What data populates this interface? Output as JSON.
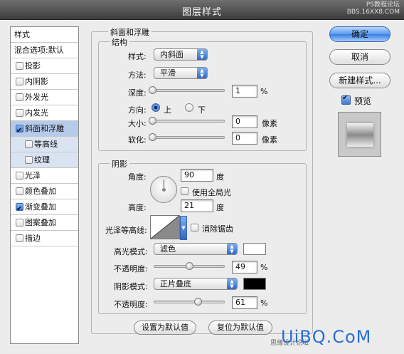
{
  "window": {
    "title": "图层样式",
    "watermark_top": "PS教程论坛\nBBS.16XX8.COM"
  },
  "style_list": {
    "items": [
      {
        "label": "样式",
        "type": "plain"
      },
      {
        "label": "混合选项:默认",
        "type": "plain"
      },
      {
        "label": "投影",
        "checked": false
      },
      {
        "label": "内阴影",
        "checked": false
      },
      {
        "label": "外发光",
        "checked": false
      },
      {
        "label": "内发光",
        "checked": false
      },
      {
        "label": "斜面和浮雕",
        "checked": true,
        "selected": true
      },
      {
        "label": "等高线",
        "checked": false,
        "sub": true
      },
      {
        "label": "纹理",
        "checked": false,
        "sub": true
      },
      {
        "label": "光泽",
        "checked": false
      },
      {
        "label": "颜色叠加",
        "checked": false
      },
      {
        "label": "渐变叠加",
        "checked": true
      },
      {
        "label": "图案叠加",
        "checked": false
      },
      {
        "label": "描边",
        "checked": false
      }
    ]
  },
  "bevel": {
    "group_title": "斜面和浮雕",
    "structure_title": "结构",
    "style_label": "样式:",
    "style_value": "内斜面",
    "technique_label": "方法:",
    "technique_value": "平滑",
    "depth_label": "深度:",
    "depth_value": "1",
    "depth_unit": "%",
    "direction_label": "方向:",
    "direction_up": "上",
    "direction_down": "下",
    "size_label": "大小:",
    "size_value": "0",
    "size_unit": "像素",
    "soften_label": "软化:",
    "soften_value": "0",
    "soften_unit": "像素"
  },
  "shading": {
    "title": "阴影",
    "angle_label": "角度:",
    "angle_value": "90",
    "angle_unit": "度",
    "global_light_label": "使用全局光",
    "altitude_label": "高度:",
    "altitude_value": "21",
    "altitude_unit": "度",
    "gloss_contour_label": "光泽等高线:",
    "antialias_label": "消除锯齿",
    "highlight_mode_label": "高光模式:",
    "highlight_mode_value": "滤色",
    "highlight_color": "#ffffff",
    "highlight_opacity_label": "不透明度:",
    "highlight_opacity_value": "49",
    "highlight_opacity_unit": "%",
    "shadow_mode_label": "阴影模式:",
    "shadow_mode_value": "正片叠底",
    "shadow_color": "#000000",
    "shadow_opacity_label": "不透明度:",
    "shadow_opacity_value": "61",
    "shadow_opacity_unit": "%"
  },
  "footer": {
    "make_default": "设置为默认值",
    "reset_default": "复位为默认值"
  },
  "side": {
    "ok": "确定",
    "cancel": "取消",
    "new_style": "新建样式...",
    "preview_label": "预览",
    "preview_checked": true
  },
  "brand_watermark": "UiBQ.CoM",
  "brand_watermark_small": "思缘设计论坛"
}
